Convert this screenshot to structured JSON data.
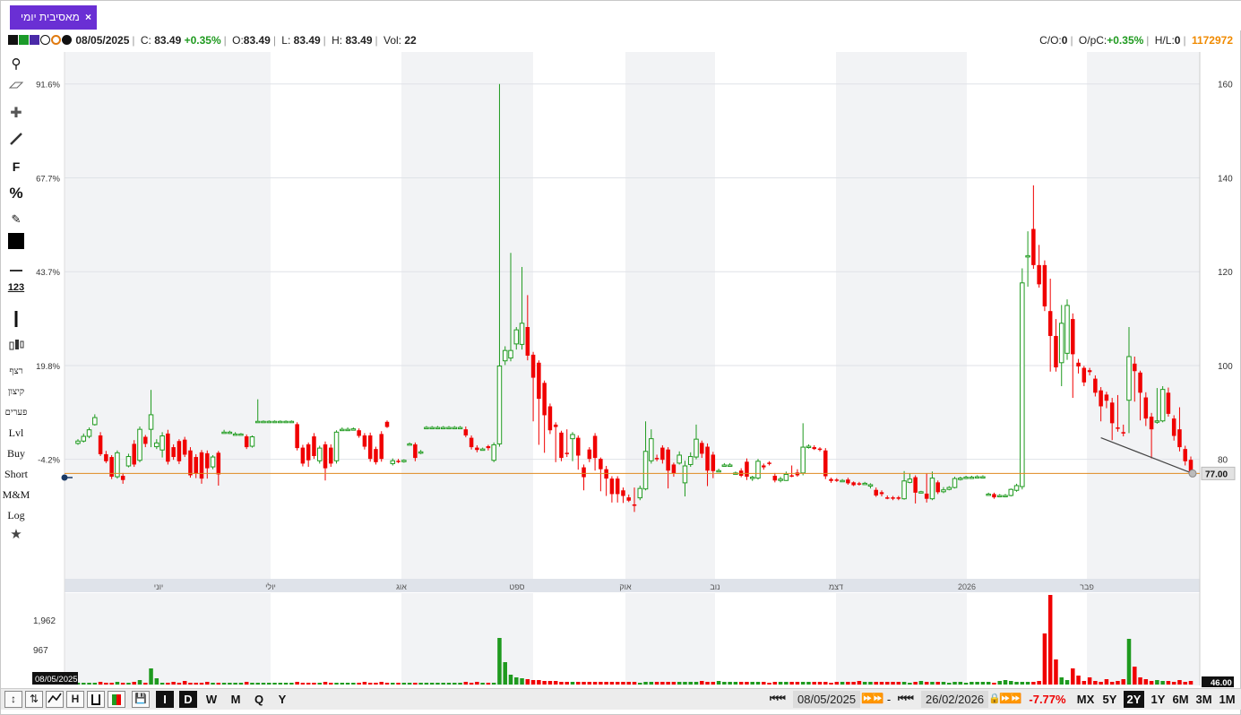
{
  "tab": {
    "title": "מאסיבית יומי",
    "close": "×"
  },
  "info": {
    "date": "08/05/2025",
    "close_label": "C:",
    "close": "83.49",
    "change": "+0.35%",
    "open_label": "O:",
    "open": "83.49",
    "low_label": "L:",
    "low": "83.49",
    "high_label": "H:",
    "high": "83.49",
    "vol_label": "Vol:",
    "vol": "22",
    "co_label": "C/O:",
    "co": "0",
    "opc_label": "O/pC:",
    "opc": "+0.35%",
    "hl_label": "H/L:",
    "hl": "0",
    "id": "1172972"
  },
  "toolbar": {
    "icons": [
      "search-icon",
      "eraser-icon",
      "crosshair-icon",
      "line-icon",
      "fibonacci-icon",
      "percent-icon",
      "edit-icon",
      "color-square-icon",
      "horizontal-line-icon",
      "ruler-icon",
      "vertical-line-icon",
      "candle-style-icon"
    ],
    "f_label": "F",
    "percent_label": "%",
    "ruler_label": "123",
    "labels": [
      "רצף",
      "קיצון",
      "פערים",
      "Lvl",
      "Buy",
      "Short",
      "M&M",
      "Log"
    ]
  },
  "chart_data": {
    "type": "candlestick",
    "last_price": 77.0,
    "last_price_label": "77.00",
    "right_axis": {
      "ticks": [
        80,
        100,
        120,
        140,
        160
      ],
      "range": [
        66,
        163
      ]
    },
    "left_axis": {
      "labels": [
        "91.6%",
        "67.7%",
        "43.7%",
        "19.8%",
        "-4.2%"
      ]
    },
    "months": [
      "יוני",
      "יולי",
      "אוג",
      "ספט",
      "אוק",
      "נוב",
      "דצמ",
      "2026",
      "פבר"
    ],
    "volume_axis": {
      "labels": [
        "1,962",
        "967"
      ],
      "last_label": "46.00"
    },
    "volume_date_label": "08/05/2025",
    "candles": [
      [
        83.4,
        83.9,
        84.3,
        83.1
      ],
      [
        83.9,
        84.9,
        85.5,
        83.6
      ],
      [
        84.9,
        86.3,
        86.8,
        84.5
      ],
      [
        87.4,
        88.9,
        89.6,
        87.2
      ],
      [
        85.1,
        81.1,
        85.8,
        80.7
      ],
      [
        81.1,
        79.6,
        81.8,
        79.2
      ],
      [
        80.5,
        76.3,
        80.9,
        75.8
      ],
      [
        76.3,
        81.4,
        81.9,
        75.9
      ],
      [
        76.5,
        75.6,
        77.1,
        74.8
      ],
      [
        78.6,
        80.6,
        81.2,
        78.3
      ],
      [
        83.3,
        78.9,
        84.1,
        78.4
      ],
      [
        79.8,
        86.4,
        87.0,
        79.4
      ],
      [
        84.8,
        83.3,
        85.2,
        82.6
      ],
      [
        86.4,
        89.5,
        94.8,
        82.6
      ],
      [
        82.7,
        83.5,
        84.3,
        82.2
      ],
      [
        82.0,
        85.0,
        85.8,
        80.4
      ],
      [
        85.5,
        79.5,
        86.3,
        78.9
      ],
      [
        82.6,
        80.5,
        83.2,
        79.9
      ],
      [
        83.9,
        79.6,
        84.3,
        79.0
      ],
      [
        84.2,
        81.0,
        84.8,
        80.5
      ],
      [
        81.9,
        76.6,
        82.6,
        76.1
      ],
      [
        80.5,
        76.9,
        81.1,
        76.0
      ],
      [
        81.5,
        75.9,
        82.0,
        74.8
      ],
      [
        81.3,
        78.1,
        81.9,
        75.9
      ],
      [
        78.4,
        80.5,
        80.9,
        77.9
      ],
      [
        81.4,
        76.8,
        81.8,
        74.4
      ],
      [
        85.7,
        85.8,
        86.3,
        85.5
      ],
      [
        85.6,
        85.8,
        86.1,
        85.4
      ],
      [
        85.4,
        85.4,
        85.8,
        85.2
      ],
      [
        85.3,
        85.4,
        85.6,
        85.1
      ],
      [
        84.9,
        82.6,
        85.3,
        82.2
      ],
      [
        82.8,
        84.8,
        85.1,
        82.5
      ],
      [
        88.1,
        88.1,
        92.8,
        87.9
      ],
      [
        88.1,
        88.1,
        88.3,
        87.9
      ],
      [
        88.1,
        88.1,
        88.3,
        87.9
      ],
      [
        88.1,
        88.1,
        88.3,
        87.9
      ],
      [
        88.1,
        88.1,
        88.3,
        87.9
      ],
      [
        88.1,
        88.1,
        88.3,
        87.9
      ],
      [
        88.1,
        88.1,
        88.3,
        87.9
      ],
      [
        87.5,
        82.4,
        87.9,
        81.9
      ],
      [
        82.5,
        79.1,
        83.1,
        78.5
      ],
      [
        83.2,
        79.8,
        83.6,
        78.4
      ],
      [
        84.9,
        80.7,
        85.6,
        80.1
      ],
      [
        79.7,
        82.4,
        82.9,
        79.1
      ],
      [
        83.2,
        78.1,
        83.8,
        75.5
      ],
      [
        82.5,
        79.1,
        83.2,
        78.4
      ],
      [
        79.7,
        85.8,
        86.2,
        79.1
      ],
      [
        86.4,
        86.4,
        86.8,
        86.2
      ],
      [
        86.4,
        86.4,
        86.8,
        86.2
      ],
      [
        86.5,
        86.5,
        86.8,
        86.3
      ],
      [
        86.2,
        85.0,
        86.6,
        84.6
      ],
      [
        85.1,
        82.7,
        85.6,
        82.1
      ],
      [
        85.1,
        80.1,
        85.7,
        79.5
      ],
      [
        82.2,
        79.4,
        82.7,
        78.9
      ],
      [
        85.4,
        80.1,
        86.0,
        79.5
      ],
      [
        88.0,
        86.9,
        88.3,
        86.7
      ],
      [
        79.1,
        79.7,
        80.2,
        78.7
      ],
      [
        79.7,
        79.5,
        80.1,
        79.2
      ],
      [
        79.5,
        79.8,
        80.0,
        79.3
      ],
      [
        83.3,
        83.3,
        83.6,
        83.1
      ],
      [
        83.2,
        80.3,
        83.6,
        79.6
      ],
      [
        81.5,
        81.6,
        82.0,
        81.1
      ],
      [
        86.8,
        86.8,
        87.1,
        86.6
      ],
      [
        86.8,
        86.8,
        87.1,
        86.6
      ],
      [
        86.8,
        86.8,
        87.1,
        86.6
      ],
      [
        86.8,
        86.8,
        87.1,
        86.6
      ],
      [
        86.8,
        86.8,
        87.1,
        86.6
      ],
      [
        86.8,
        86.8,
        87.1,
        86.6
      ],
      [
        86.8,
        86.8,
        87.1,
        86.6
      ],
      [
        86.4,
        85.1,
        87.0,
        84.7
      ],
      [
        84.6,
        82.6,
        85.1,
        82.1
      ],
      [
        82.5,
        82.0,
        83.0,
        81.5
      ],
      [
        82.2,
        82.2,
        82.5,
        81.9
      ],
      [
        82.8,
        82.4,
        83.1,
        81.9
      ],
      [
        79.8,
        83.1,
        83.6,
        79.4
      ],
      [
        83.3,
        99.9,
        160.0,
        82.7
      ],
      [
        101.0,
        103.2,
        104.1,
        100.1
      ],
      [
        101.6,
        103.2,
        124.0,
        100.9
      ],
      [
        104.6,
        107.6,
        108.2,
        103.4
      ],
      [
        104.5,
        109.0,
        121.0,
        103.4
      ],
      [
        108.2,
        102.1,
        115.0,
        101.1
      ],
      [
        102.3,
        97.4,
        102.9,
        88.1
      ],
      [
        100.6,
        92.9,
        101.1,
        83.1
      ],
      [
        96.3,
        89.4,
        96.8,
        81.4
      ],
      [
        91.3,
        86.2,
        91.9,
        85.4
      ],
      [
        87.4,
        86.9,
        87.9,
        79.4
      ],
      [
        85.7,
        80.3,
        86.1,
        79.6
      ],
      [
        81.4,
        81.3,
        86.4,
        80.5
      ],
      [
        84.4,
        85.3,
        85.8,
        79.6
      ],
      [
        84.6,
        80.8,
        85.1,
        77.8
      ],
      [
        78.3,
        76.2,
        78.9,
        73.4
      ],
      [
        82.1,
        80.1,
        82.6,
        79.4
      ],
      [
        85.0,
        80.3,
        85.6,
        77.6
      ],
      [
        80.1,
        77.9,
        80.4,
        73.2
      ],
      [
        77.9,
        75.9,
        78.6,
        72.2
      ],
      [
        75.9,
        72.6,
        76.4,
        70.8
      ],
      [
        75.9,
        72.6,
        76.4,
        70.8
      ],
      [
        73.4,
        72.2,
        74.0,
        70.7
      ],
      [
        71.9,
        71.2,
        72.5,
        70.9
      ],
      [
        70.4,
        70.1,
        74.0,
        68.8
      ],
      [
        71.8,
        73.8,
        74.4,
        71.3
      ],
      [
        73.7,
        81.7,
        88.1,
        73.4
      ],
      [
        79.7,
        84.4,
        86.4,
        79.1
      ],
      [
        80.3,
        80.1,
        81.0,
        79.6
      ],
      [
        82.5,
        79.9,
        83.0,
        79.1
      ],
      [
        82.1,
        77.6,
        82.6,
        73.8
      ],
      [
        78.9,
        77.0,
        79.3,
        76.3
      ],
      [
        79.2,
        80.9,
        81.7,
        78.9
      ],
      [
        75.0,
        78.6,
        79.7,
        72.1
      ],
      [
        78.9,
        80.6,
        81.5,
        78.4
      ],
      [
        80.5,
        84.3,
        87.4,
        80.0
      ],
      [
        83.5,
        81.2,
        84.0,
        80.3
      ],
      [
        82.7,
        77.6,
        83.4,
        74.3
      ],
      [
        81.0,
        77.5,
        81.6,
        76.0
      ],
      [
        77.6,
        77.6,
        78.0,
        77.4
      ],
      [
        78.8,
        78.8,
        79.2,
        78.6
      ],
      [
        78.8,
        78.8,
        79.2,
        78.6
      ],
      [
        77.1,
        77.1,
        77.4,
        76.9
      ],
      [
        77.6,
        76.5,
        78.1,
        76.2
      ],
      [
        79.5,
        76.3,
        80.2,
        75.6
      ],
      [
        76.1,
        76.2,
        76.5,
        75.4
      ],
      [
        76.0,
        79.6,
        80.1,
        75.7
      ],
      [
        78.7,
        78.3,
        79.1,
        77.8
      ],
      [
        79.3,
        79.2,
        79.6,
        78.7
      ],
      [
        76.5,
        75.5,
        77.1,
        75.1
      ],
      [
        75.5,
        75.8,
        76.3,
        75.1
      ],
      [
        75.5,
        76.8,
        77.4,
        75.4
      ],
      [
        76.6,
        76.4,
        78.7,
        76.2
      ],
      [
        77.2,
        76.6,
        77.9,
        76.3
      ],
      [
        77.1,
        82.6,
        87.7,
        76.6
      ],
      [
        82.6,
        82.8,
        83.2,
        82.3
      ],
      [
        82.6,
        82.2,
        83.0,
        82.0
      ],
      [
        82.3,
        82.1,
        82.6,
        81.7
      ],
      [
        81.9,
        76.4,
        82.4,
        75.8
      ],
      [
        75.8,
        75.4,
        76.1,
        75.0
      ],
      [
        75.7,
        75.5,
        76.0,
        75.2
      ],
      [
        75.5,
        75.5,
        75.8,
        75.2
      ],
      [
        75.7,
        74.9,
        76.1,
        74.6
      ],
      [
        75.1,
        74.5,
        75.3,
        74.3
      ],
      [
        74.9,
        74.7,
        75.2,
        74.4
      ],
      [
        74.9,
        74.9,
        75.2,
        74.7
      ],
      [
        74.3,
        74.6,
        74.9,
        73.8
      ],
      [
        73.5,
        72.3,
        74.0,
        72.0
      ],
      [
        73.0,
        72.6,
        73.4,
        72.1
      ],
      [
        71.9,
        71.8,
        72.3,
        71.5
      ],
      [
        71.9,
        71.7,
        72.2,
        71.3
      ],
      [
        71.9,
        71.6,
        72.2,
        71.3
      ],
      [
        71.6,
        75.4,
        77.5,
        71.4
      ],
      [
        75.1,
        75.8,
        77.0,
        74.9
      ],
      [
        76.2,
        72.9,
        76.6,
        70.6
      ],
      [
        73.1,
        73.1,
        73.3,
        72.8
      ],
      [
        72.7,
        71.6,
        77.0,
        70.8
      ],
      [
        71.6,
        76.0,
        77.4,
        71.3
      ],
      [
        75.1,
        73.0,
        75.5,
        72.6
      ],
      [
        73.1,
        73.5,
        74.1,
        72.8
      ],
      [
        73.6,
        74.0,
        74.3,
        73.4
      ],
      [
        74.0,
        75.9,
        76.3,
        73.8
      ],
      [
        75.7,
        76.0,
        76.3,
        75.5
      ],
      [
        76.0,
        76.2,
        76.5,
        75.8
      ],
      [
        76.1,
        76.2,
        76.5,
        75.9
      ],
      [
        76.2,
        76.3,
        76.6,
        76.0
      ],
      [
        76.3,
        76.3,
        76.6,
        76.1
      ],
      [
        72.5,
        72.6,
        72.9,
        72.3
      ],
      [
        72.6,
        71.9,
        72.9,
        71.6
      ],
      [
        72.3,
        72.3,
        72.6,
        72.1
      ],
      [
        72.3,
        72.3,
        72.6,
        72.1
      ],
      [
        72.3,
        73.6,
        73.8,
        72.1
      ],
      [
        73.4,
        74.4,
        74.8,
        73.1
      ],
      [
        74.2,
        117.6,
        120.7,
        73.6
      ],
      [
        123.4,
        123.4,
        128.6,
        116.8
      ],
      [
        129.1,
        121.4,
        138.4,
        120.6
      ],
      [
        121.4,
        117.3,
        125.7,
        116.6
      ],
      [
        121.4,
        112.6,
        122.4,
        111.6
      ],
      [
        111.6,
        106.3,
        118.5,
        98.7
      ],
      [
        106.3,
        99.6,
        109.9,
        98.7
      ],
      [
        100.6,
        109.0,
        112.9,
        95.6
      ],
      [
        102.6,
        112.8,
        114.1,
        101.2
      ],
      [
        109.9,
        102.4,
        111.1,
        93.1
      ],
      [
        100.6,
        99.8,
        101.4,
        98.3
      ],
      [
        99.5,
        96.4,
        99.9,
        95.6
      ],
      [
        99.0,
        98.6,
        99.5,
        97.9
      ],
      [
        97.2,
        94.2,
        97.9,
        93.4
      ],
      [
        94.7,
        91.3,
        95.4,
        88.1
      ],
      [
        93.8,
        92.5,
        94.4,
        90.9
      ],
      [
        92.1,
        87.7,
        93.1,
        84.1
      ],
      [
        86.8,
        86.6,
        93.7,
        85.9
      ],
      [
        85.8,
        85.6,
        87.4,
        84.9
      ],
      [
        92.6,
        101.9,
        108.2,
        85.6
      ],
      [
        100.4,
        98.8,
        101.9,
        92.3
      ],
      [
        98.5,
        94.2,
        98.9,
        88.3
      ],
      [
        93.2,
        88.7,
        94.3,
        87.1
      ],
      [
        89.1,
        86.4,
        89.9,
        80.2
      ],
      [
        88.0,
        88.2,
        95.2,
        87.6
      ],
      [
        88.2,
        94.9,
        95.6,
        87.9
      ],
      [
        94.2,
        89.7,
        95.3,
        89.1
      ],
      [
        88.7,
        85.0,
        89.4,
        84.0
      ],
      [
        86.4,
        82.6,
        91.1,
        81.7
      ],
      [
        82.2,
        79.6,
        82.9,
        78.7
      ],
      [
        79.9,
        77.0,
        80.6,
        76.4
      ]
    ],
    "volumes": [
      2,
      2,
      2,
      2,
      3,
      2,
      2,
      3,
      2,
      2,
      3,
      5,
      2,
      18,
      7,
      2,
      2,
      3,
      2,
      4,
      2,
      2,
      2,
      3,
      2,
      2,
      2,
      2,
      2,
      2,
      3,
      2,
      2,
      2,
      2,
      2,
      2,
      2,
      2,
      3,
      2,
      2,
      2,
      2,
      3,
      2,
      2,
      2,
      2,
      2,
      2,
      3,
      2,
      2,
      3,
      2,
      2,
      2,
      2,
      2,
      2,
      2,
      2,
      2,
      2,
      2,
      2,
      2,
      2,
      3,
      2,
      3,
      2,
      2,
      2,
      52,
      25,
      11,
      8,
      7,
      6,
      5,
      5,
      4,
      4,
      4,
      3,
      3,
      3,
      3,
      3,
      3,
      3,
      3,
      3,
      3,
      3,
      3,
      3,
      3,
      2,
      3,
      3,
      3,
      3,
      3,
      3,
      3,
      3,
      3,
      3,
      4,
      3,
      3,
      4,
      3,
      3,
      3,
      3,
      3,
      3,
      3,
      3,
      2,
      3,
      3,
      3,
      3,
      3,
      3,
      3,
      3,
      3,
      3,
      2,
      3,
      3,
      3,
      3,
      4,
      3,
      3,
      3,
      3,
      3,
      3,
      3,
      3,
      2,
      3,
      4,
      3,
      3,
      3,
      3,
      2,
      3,
      3,
      2,
      3,
      3,
      3,
      3,
      2,
      4,
      5,
      4,
      3,
      3,
      3,
      3,
      4,
      57,
      100,
      28,
      8,
      5,
      18,
      10,
      4,
      8,
      4,
      3,
      6,
      3,
      4,
      6,
      51,
      20,
      8,
      6,
      4,
      5,
      4,
      4,
      3,
      5,
      3,
      4
    ]
  },
  "bottom": {
    "from_date": "08/05/2025",
    "dash": "-",
    "to_date": "26/02/2026",
    "change": "-7.77%",
    "ranges": [
      "MX",
      "5Y",
      "2Y",
      "1Y",
      "6M",
      "3M",
      "1M"
    ],
    "selected_range": "2Y",
    "periods": [
      "I",
      "D",
      "W",
      "M",
      "Q",
      "Y"
    ],
    "selected_period": "I"
  },
  "colors": {
    "up": "#1f9a1f",
    "down": "#f00000",
    "accent": "#6a2fd4",
    "last_line": "#e08a20"
  }
}
